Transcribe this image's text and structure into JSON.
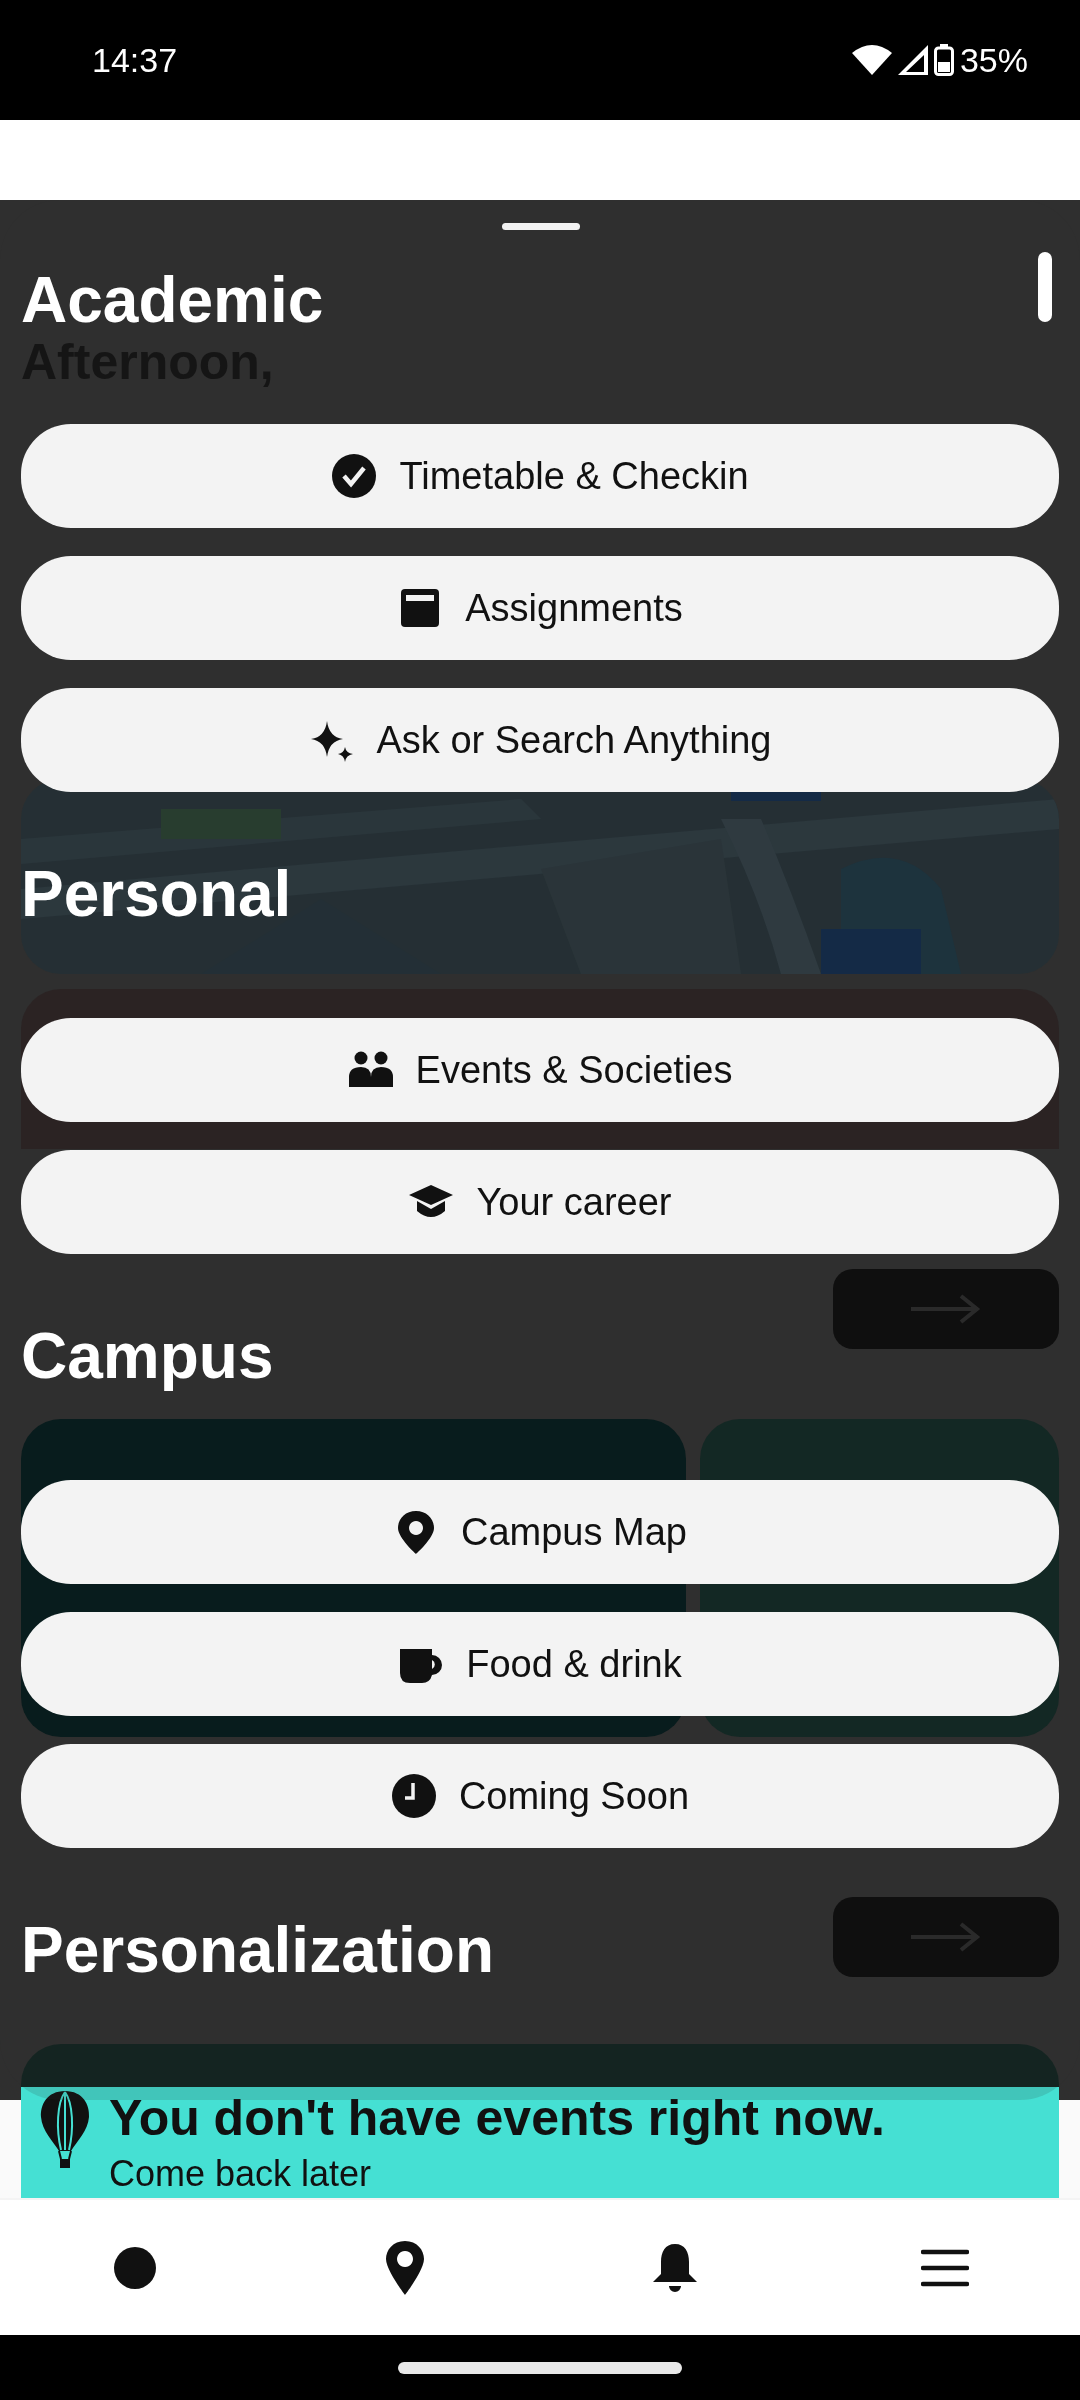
{
  "status_bar": {
    "time": "14:37",
    "battery": "35%"
  },
  "background_page": {
    "greeting": "Afternoon,",
    "empty_state": {
      "title": "You don't have events right now.",
      "subtitle": "Come back later"
    }
  },
  "sheet": {
    "sections": [
      {
        "title": "Academic",
        "items": [
          {
            "label": "Timetable & Checkin",
            "kind": "check"
          },
          {
            "label": "Assignments",
            "kind": "calendar"
          },
          {
            "label": "Ask or Search Anything",
            "kind": "sparkle"
          }
        ]
      },
      {
        "title": "Personal",
        "items": [
          {
            "label": "Events & Societies",
            "kind": "people"
          },
          {
            "label": "Your career",
            "kind": "cap"
          }
        ]
      },
      {
        "title": "Campus",
        "items": [
          {
            "label": "Campus Map",
            "kind": "pin"
          },
          {
            "label": "Food & drink",
            "kind": "cup"
          },
          {
            "label": "Coming Soon",
            "kind": "clock"
          }
        ]
      },
      {
        "title": "Personalization"
      }
    ]
  },
  "bottom_nav": [
    {
      "kind": "dot"
    },
    {
      "kind": "pin"
    },
    {
      "kind": "bell"
    },
    {
      "kind": "menu"
    }
  ]
}
